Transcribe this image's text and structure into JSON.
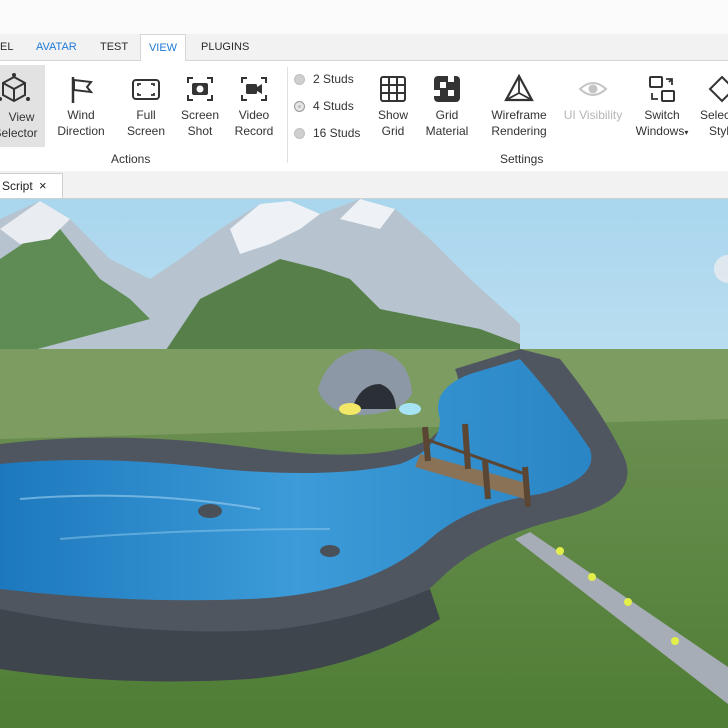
{
  "tabs": [
    {
      "label": "EL"
    },
    {
      "label": "AVATAR"
    },
    {
      "label": "TEST"
    },
    {
      "label": "VIEW"
    },
    {
      "label": "PLUGINS"
    }
  ],
  "ribbon": {
    "view_selector": [
      "View",
      "Selector"
    ],
    "wind_direction": [
      "Wind",
      "Direction"
    ],
    "full_screen": [
      "Full",
      "Screen"
    ],
    "screen_shot": [
      "Screen",
      "Shot"
    ],
    "video_record": [
      "Video",
      "Record"
    ],
    "actions_label": "Actions",
    "studs": [
      "2 Studs",
      "4 Studs",
      "16 Studs"
    ],
    "selected_studs": "4 Studs",
    "show_grid": [
      "Show",
      "Grid"
    ],
    "grid_material": [
      "Grid",
      "Material"
    ],
    "wireframe_rendering": [
      "Wireframe",
      "Rendering"
    ],
    "ui_visibility": "UI Visibility",
    "switch_windows": [
      "Switch",
      "Windows"
    ],
    "selection_style": [
      "Selec",
      "Styl"
    ],
    "settings_label": "Settings"
  },
  "doc_tab": {
    "label": "Script",
    "close": "×"
  },
  "colors": {
    "accent": "#1f7ad6",
    "sky": "#cfe6f2",
    "grass": "#5f8d45",
    "water": "#2e86c9",
    "rock": "#4f5560"
  }
}
